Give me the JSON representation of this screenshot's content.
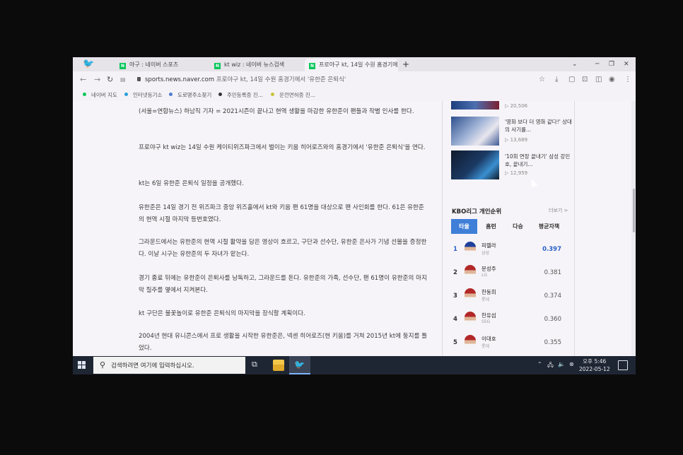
{
  "browser": {
    "tabs": [
      {
        "label": "야구 : 네이버 스포츠",
        "favicon": "N"
      },
      {
        "label": "kt wiz : 네이버 뉴스검색",
        "favicon": "N"
      },
      {
        "label": "프로야구 kt, 14일 수원 홈경기에",
        "favicon": "N"
      }
    ],
    "new_tab": "+",
    "url_host": "sports.news.naver.com",
    "url_rest": "프로야구 kt, 14일 수원 홈경기에서 '유한준 은퇴식'",
    "bookmarks": [
      {
        "label": "네이버 지도",
        "color": "#03c75a"
      },
      {
        "label": "인터넷등기소",
        "color": "#2aa0d8"
      },
      {
        "label": "도로명주소찾기",
        "color": "#4f7ccc"
      },
      {
        "label": "주민등록증 진...",
        "color": "#333333"
      },
      {
        "label": "운전면허증 진...",
        "color": "#c8c23a"
      }
    ]
  },
  "article": {
    "paragraphs": [
      "(서울=연합뉴스) 하남직 기자 = 2021시즌이 끝나고 현역 생활을 마감한 유한준이 팬들과 작별 인사를 한다.",
      "프로야구 kt wiz는 14일 수원 케이티위즈파크에서 벌이는 키움 히어로즈와의 홈경기에서 '유한준 은퇴식'을 연다.",
      "kt는 6일 유한준 은퇴식 일정을 공개했다.",
      "유한준은 14일 경기 전 위즈파크 중앙 위즈홀에서 kt와 키움 팬 61명을 대상으로 팬 사인회를 한다. 61은 유한준의 현역 시절 마지막 등번호였다.",
      "그라운드에서는 유한준의 현역 시절 활약을 담은 영상이 흐르고, 구단과 선수단, 유한준 은사가 기념 선물을 증정한다. 이날 시구는 유한준의 두 자녀가 맡는다.",
      "경기 종료 뒤에는 유한준이 은퇴사를 낭독하고, 그라운드를 돈다. 유한준의 가족, 선수단, 팬 61명이 유한준의 마지막 질주를 옆에서 지켜본다.",
      "kt 구단은 불꽃놀이로 유한준 은퇴식의 마지막을 장식할 계획이다.",
      "2004년 현대 유니콘스에서 프로 생활을 시작한 유한준은, 넥센 히어로즈(현 키움)를 거쳐 2015년 kt에 둥지를 틀었다."
    ]
  },
  "sidebar": {
    "videos": [
      {
        "title": "",
        "views": "▷ 20,506"
      },
      {
        "title": "'영화 보다 더 영화 같다!' 상대의 사기를...",
        "views": "▷ 13,689"
      },
      {
        "title": "'10회 연장 끝내기' 삼성 강민호, 끝내기...",
        "views": "▷ 12,959"
      }
    ],
    "ranking_title": "KBO리그 개인순위",
    "more": "더보기 >",
    "tabs": [
      "타율",
      "홈런",
      "다승",
      "평균자책"
    ],
    "rows": [
      {
        "rank": "1",
        "name": "피렐라",
        "team": "삼성",
        "value": "0.397"
      },
      {
        "rank": "2",
        "name": "문성주",
        "team": "LG",
        "value": "0.381"
      },
      {
        "rank": "3",
        "name": "한동희",
        "team": "롯데",
        "value": "0.374"
      },
      {
        "rank": "4",
        "name": "한유섬",
        "team": "SSG",
        "value": "0.360"
      },
      {
        "rank": "5",
        "name": "이대호",
        "team": "롯데",
        "value": "0.355"
      }
    ]
  },
  "taskbar": {
    "search_placeholder": "검색하려면 여기에 입력하십시오.",
    "time": "오후 5:46",
    "date": "2022-05-12"
  }
}
